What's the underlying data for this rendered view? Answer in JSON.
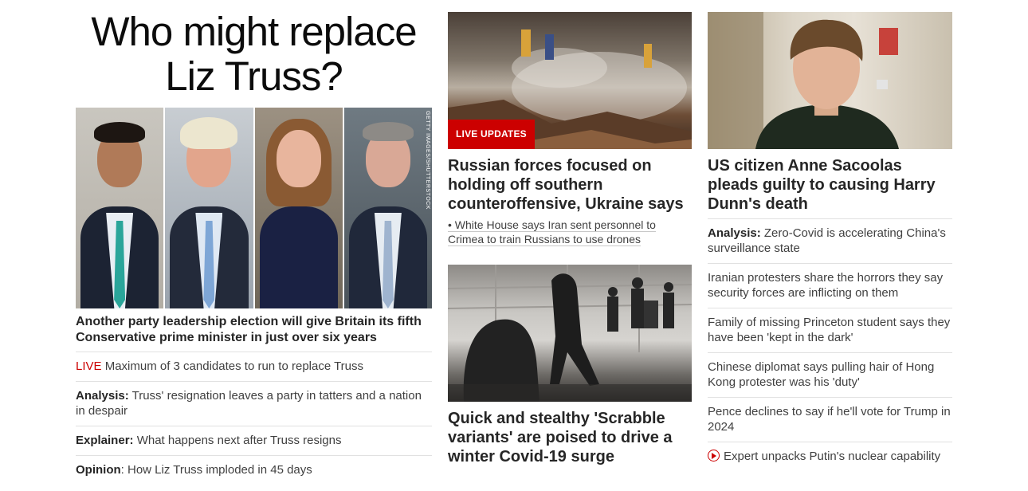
{
  "left": {
    "big_headline_line1": "Who might replace",
    "big_headline_line2": "Liz Truss?",
    "photo_credit": "GETTY IMAGES/SHUTTERSTOCK",
    "lead_headline": "Another party leadership election will give Britain its fifth Conservative prime minister in just over six years",
    "items": [
      {
        "tag": "LIVE",
        "text": " Maximum of 3 candidates to run to replace Truss"
      },
      {
        "tag": "Analysis:",
        "text": " Truss' resignation leaves a party in tatters and a nation in despair"
      },
      {
        "tag": "Explainer:",
        "text": " What happens next after Truss resigns"
      },
      {
        "tag": "Opinion",
        "text": ": How Liz Truss imploded in 45 days"
      }
    ]
  },
  "middle": {
    "story1": {
      "badge": "LIVE UPDATES",
      "headline": "Russian forces focused on holding off southern counteroffensive, Ukraine says",
      "sub": "• White House says Iran sent personnel to Crimea to train Russians to use drones"
    },
    "story2": {
      "headline": "Quick and stealthy 'Scrabble variants' are poised to drive a winter Covid-19 surge"
    }
  },
  "right": {
    "headline": "US citizen Anne Sacoolas pleads guilty to causing Harry Dunn's death",
    "items": [
      {
        "tag": "Analysis:",
        "text": " Zero-Covid is accelerating China's surveillance state"
      },
      {
        "tag": "",
        "text": "Iranian protesters share the horrors they say security forces are inflicting on them"
      },
      {
        "tag": "",
        "text": "Family of missing Princeton student says they have been 'kept in the dark'"
      },
      {
        "tag": "",
        "text": "Chinese diplomat says pulling hair of Hong Kong protester was his 'duty'"
      },
      {
        "tag": "",
        "text": "Pence declines to say if he'll vote for Trump in 2024"
      }
    ],
    "video_item": {
      "icon": "play-circle-icon",
      "text": "Expert unpacks Putin's nuclear capability"
    }
  },
  "colors": {
    "accent_red": "#cc0000",
    "text_dark": "#262626",
    "divider": "#e1e1e1"
  }
}
